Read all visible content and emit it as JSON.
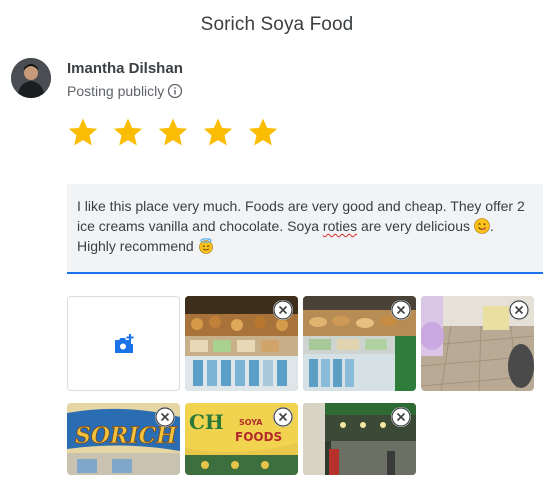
{
  "header": {
    "title": "Sorich Soya Food"
  },
  "user": {
    "name": "Imantha Dilshan",
    "visibility": "Posting publicly",
    "info_icon": "info-icon"
  },
  "rating": {
    "value": 5,
    "max": 5,
    "star_color": "#fbbc04"
  },
  "review": {
    "part1": "I like this place very much. Foods are very good and cheap. They offer 2 ice creams vanilla and chocolate. Soya ",
    "misspelled_word": "roties",
    "part2": " are very delicious ",
    "part3": ". Highly recommend ",
    "emoji_1": "yum-face-emoji",
    "emoji_2": "smiling-face-with-halo-emoji"
  },
  "photos": {
    "add_icon": "add-photo-icon",
    "remove_icon": "close-icon",
    "items": [
      {
        "subject": "food display counter"
      },
      {
        "subject": "bakery glass case"
      },
      {
        "subject": "tiled floor shop"
      },
      {
        "subject": "sorich sign"
      },
      {
        "subject": "soya foods sign"
      },
      {
        "subject": "shop front"
      }
    ]
  },
  "colors": {
    "accent": "#1a73e8",
    "text": "#3c4043",
    "secondary": "#5f6368"
  }
}
